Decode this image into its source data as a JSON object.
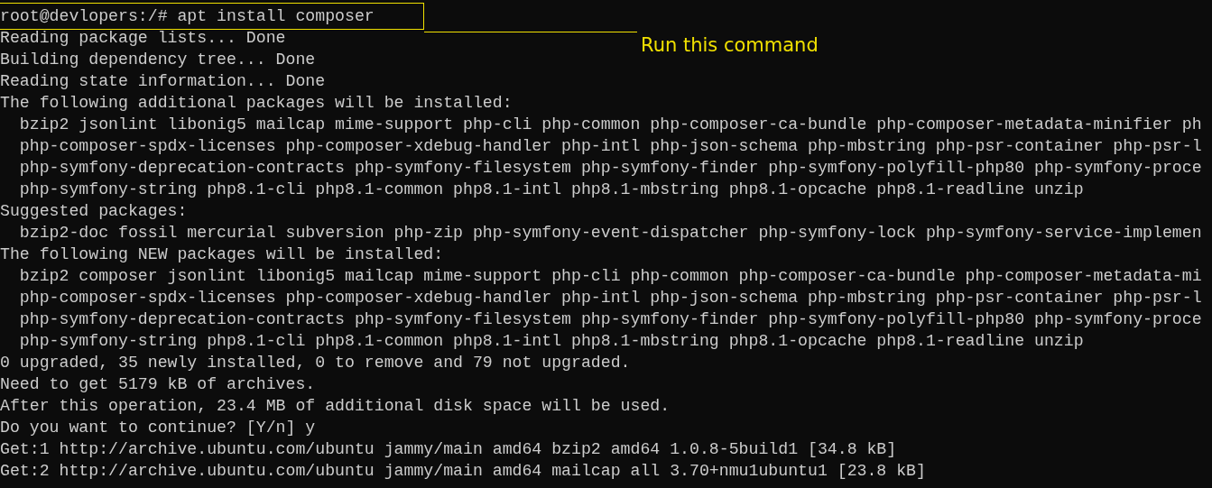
{
  "terminal": {
    "lines": [
      {
        "kind": "command",
        "text": "root@devlopers:/# apt install composer"
      },
      {
        "kind": "output",
        "text": "Reading package lists... Done"
      },
      {
        "kind": "output",
        "text": "Building dependency tree... Done"
      },
      {
        "kind": "output",
        "text": "Reading state information... Done"
      },
      {
        "kind": "output",
        "text": "The following additional packages will be installed:"
      },
      {
        "kind": "output",
        "text": "  bzip2 jsonlint libonig5 mailcap mime-support php-cli php-common php-composer-ca-bundle php-composer-metadata-minifier ph"
      },
      {
        "kind": "output",
        "text": "  php-composer-spdx-licenses php-composer-xdebug-handler php-intl php-json-schema php-mbstring php-psr-container php-psr-l"
      },
      {
        "kind": "output",
        "text": "  php-symfony-deprecation-contracts php-symfony-filesystem php-symfony-finder php-symfony-polyfill-php80 php-symfony-proce"
      },
      {
        "kind": "output",
        "text": "  php-symfony-string php8.1-cli php8.1-common php8.1-intl php8.1-mbstring php8.1-opcache php8.1-readline unzip"
      },
      {
        "kind": "output",
        "text": "Suggested packages:"
      },
      {
        "kind": "output",
        "text": "  bzip2-doc fossil mercurial subversion php-zip php-symfony-event-dispatcher php-symfony-lock php-symfony-service-implemen"
      },
      {
        "kind": "output",
        "text": "The following NEW packages will be installed:"
      },
      {
        "kind": "output",
        "text": "  bzip2 composer jsonlint libonig5 mailcap mime-support php-cli php-common php-composer-ca-bundle php-composer-metadata-mi"
      },
      {
        "kind": "output",
        "text": "  php-composer-spdx-licenses php-composer-xdebug-handler php-intl php-json-schema php-mbstring php-psr-container php-psr-l"
      },
      {
        "kind": "output",
        "text": "  php-symfony-deprecation-contracts php-symfony-filesystem php-symfony-finder php-symfony-polyfill-php80 php-symfony-proce"
      },
      {
        "kind": "output",
        "text": "  php-symfony-string php8.1-cli php8.1-common php8.1-intl php8.1-mbstring php8.1-opcache php8.1-readline unzip"
      },
      {
        "kind": "output",
        "text": "0 upgraded, 35 newly installed, 0 to remove and 79 not upgraded."
      },
      {
        "kind": "output",
        "text": "Need to get 5179 kB of archives."
      },
      {
        "kind": "output",
        "text": "After this operation, 23.4 MB of additional disk space will be used."
      },
      {
        "kind": "output",
        "text": "Do you want to continue? [Y/n] y"
      },
      {
        "kind": "output",
        "text": "Get:1 http://archive.ubuntu.com/ubuntu jammy/main amd64 bzip2 amd64 1.0.8-5build1 [34.8 kB]"
      },
      {
        "kind": "output",
        "text": "Get:2 http://archive.ubuntu.com/ubuntu jammy/main amd64 mailcap all 3.70+nmu1ubuntu1 [23.8 kB]"
      }
    ]
  },
  "annotation": {
    "text": "Run this command"
  }
}
